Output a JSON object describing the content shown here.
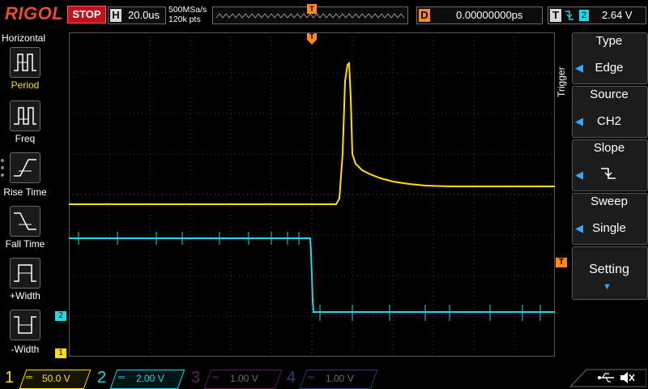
{
  "brand": "RIGOL",
  "run_state": "STOP",
  "timebase": {
    "tag": "H",
    "value": "20.0us",
    "sample_rate": "500MSa/s",
    "points": "120k pts"
  },
  "trigger_marker": "T",
  "delay": {
    "tag": "D",
    "value": "0.00000000ps"
  },
  "trigger_status": {
    "tag": "T",
    "channel": "2",
    "level": "2.64 V"
  },
  "left_panel": {
    "title": "Horizontal",
    "items": [
      {
        "label": "Period",
        "icon": "period-icon"
      },
      {
        "label": "Freq",
        "icon": "frequency-icon"
      },
      {
        "label": "Rise Time",
        "icon": "rise-time-icon"
      },
      {
        "label": "Fall Time",
        "icon": "fall-time-icon"
      },
      {
        "label": "+Width",
        "icon": "positive-width-icon"
      },
      {
        "label": "-Width",
        "icon": "negative-width-icon"
      }
    ]
  },
  "right_panel": {
    "side_title": "Trigger",
    "items": [
      {
        "label": "Type",
        "value": "Edge"
      },
      {
        "label": "Source",
        "value": "CH2"
      },
      {
        "label": "Slope",
        "value": "falling-edge-icon"
      },
      {
        "label": "Sweep",
        "value": "Single"
      },
      {
        "label": "Setting",
        "value": ""
      }
    ]
  },
  "markers": {
    "ch1": "1",
    "ch2": "2",
    "trigger_level": "T"
  },
  "channels": [
    {
      "num": "1",
      "scale": "50.0 V",
      "color": "#ffe000",
      "active": true
    },
    {
      "num": "2",
      "scale": "2.00 V",
      "color": "#20d8e8",
      "active": true
    },
    {
      "num": "3",
      "scale": "1.00 V",
      "color": "#d020c8",
      "active": false
    },
    {
      "num": "4",
      "scale": "1.00 V",
      "color": "#3a6cff",
      "active": false
    }
  ],
  "colors": {
    "ch1": "#ffe000",
    "ch2": "#20d8e8",
    "accent": "#ff8a1a",
    "stop": "#c0121a"
  }
}
